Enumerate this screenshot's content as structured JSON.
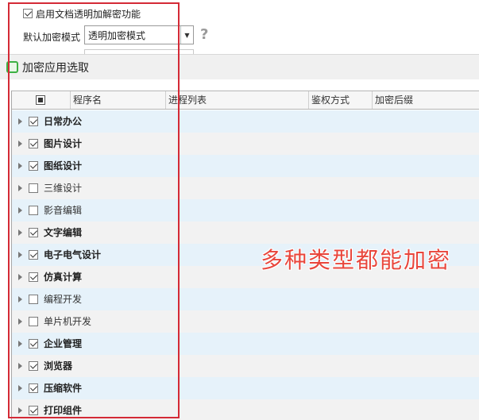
{
  "settings": {
    "enable_label": "启用文档透明加解密功能",
    "enable_checked": true,
    "mode_label": "默认加密模式",
    "mode_value": "透明加密模式",
    "help_glyph": "?"
  },
  "section": {
    "title": "加密应用选取"
  },
  "table": {
    "columns": [
      "程序名",
      "进程列表",
      "鉴权方式",
      "加密后缀"
    ],
    "header_checkbox_state": "indeterminate",
    "rows": [
      {
        "label": "日常办公",
        "checked": true
      },
      {
        "label": "图片设计",
        "checked": true
      },
      {
        "label": "图纸设计",
        "checked": true
      },
      {
        "label": "三维设计",
        "checked": false
      },
      {
        "label": "影音编辑",
        "checked": false
      },
      {
        "label": "文字编辑",
        "checked": true
      },
      {
        "label": "电子电气设计",
        "checked": true
      },
      {
        "label": "仿真计算",
        "checked": true
      },
      {
        "label": "编程开发",
        "checked": false
      },
      {
        "label": "单片机开发",
        "checked": false
      },
      {
        "label": "企业管理",
        "checked": true
      },
      {
        "label": "浏览器",
        "checked": true
      },
      {
        "label": "压缩软件",
        "checked": true
      },
      {
        "label": "打印组件",
        "checked": true
      }
    ]
  },
  "annotation": {
    "text": "多种类型都能加密",
    "color": "#e8463c",
    "box_color": "#d42a36"
  },
  "colors": {
    "row_even": "#e6f2fa",
    "row_odd": "#f2f2f2",
    "accent_green": "#3cb043"
  }
}
